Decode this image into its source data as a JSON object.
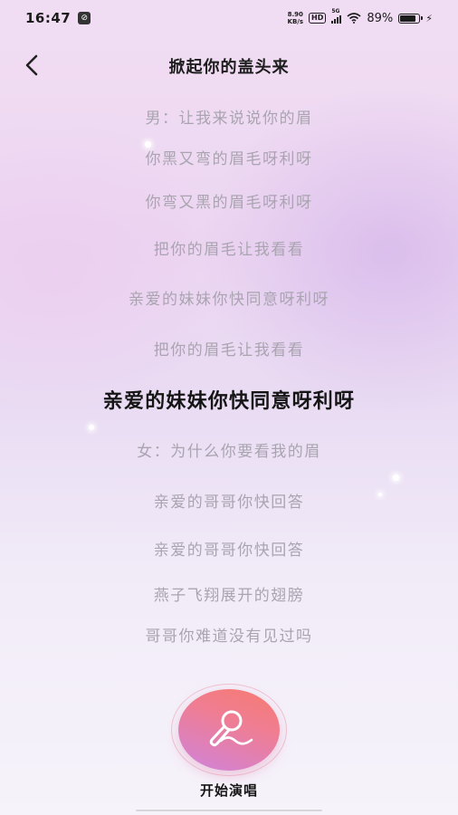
{
  "status_bar": {
    "time": "16:47",
    "net_speed_value": "8.90",
    "net_speed_unit": "KB/s",
    "hd_label": "HD",
    "signal_label": "5G",
    "battery": "89%"
  },
  "header": {
    "title": "掀起你的盖头来"
  },
  "lyrics": {
    "lines": [
      "男：让我来说说你的眉",
      "你黑又弯的眉毛呀利呀",
      "你弯又黑的眉毛呀利呀",
      "把你的眉毛让我看看",
      "亲爱的妹妹你快同意呀利呀",
      "把你的眉毛让我看看",
      "亲爱的妹妹你快同意呀利呀",
      "女：为什么你要看我的眉",
      "亲爱的哥哥你快回答",
      "亲爱的哥哥你快回答",
      "燕子飞翔展开的翅膀",
      "哥哥你难道没有见过吗"
    ],
    "current_index": 6
  },
  "controls": {
    "start_label": "开始演唱",
    "mic_icon": "microphone-icon"
  },
  "colors": {
    "lyric_inactive": "#a9a4b0",
    "lyric_active": "#151515",
    "mic_gradient_start": "#f77c6f",
    "mic_gradient_end": "#cf83dc"
  }
}
